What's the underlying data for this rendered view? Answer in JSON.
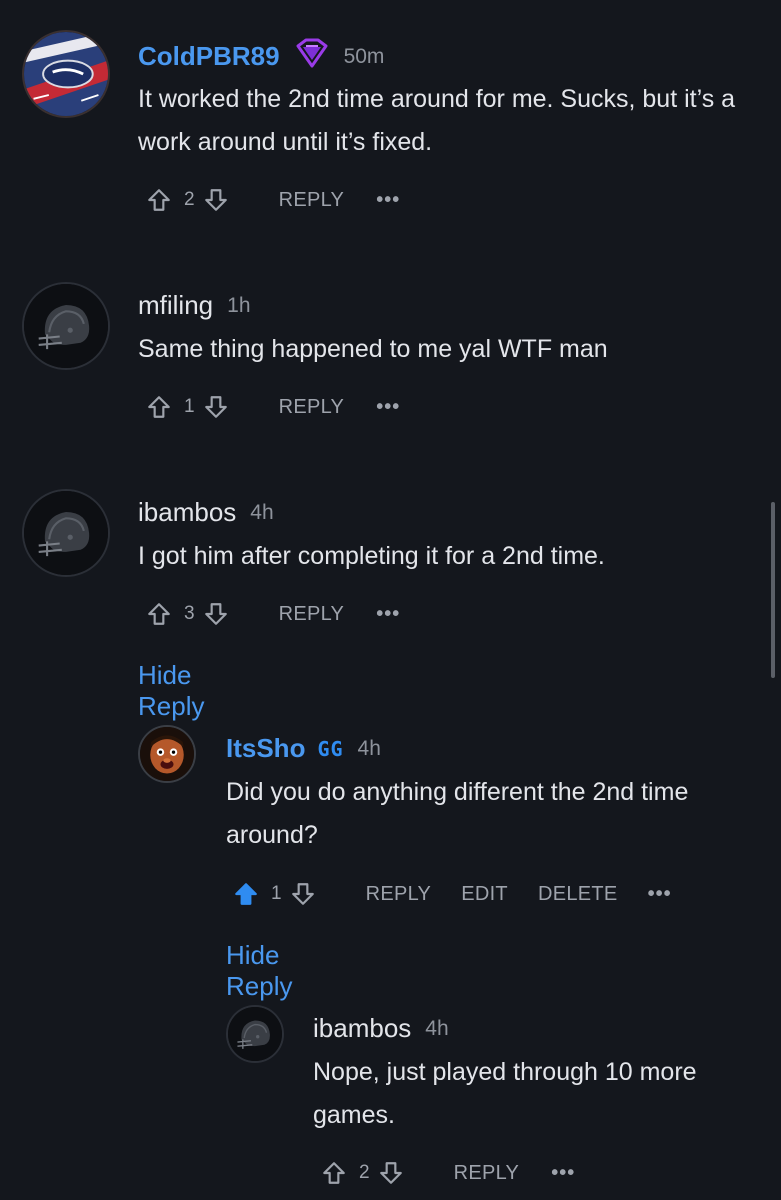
{
  "colors": {
    "background": "#14171d",
    "text": "#e3e5ea",
    "muted": "#8e939c",
    "link": "#4a98ef",
    "upvote_active": "#2f8cf1"
  },
  "comments": [
    {
      "username": "ColdPBR89",
      "badge_icon": "purple-gem-badge-icon",
      "time": "50m",
      "text": "It worked the 2nd time around for me. Sucks, but it’s a work around until it’s fixed.",
      "votes": "2",
      "reply_label": "REPLY",
      "more_label": "•••"
    },
    {
      "username": "mfiling",
      "time": "1h",
      "text": "Same thing happened to me yal WTF man",
      "votes": "1",
      "reply_label": "REPLY",
      "more_label": "•••"
    },
    {
      "username": "ibambos",
      "time": "4h",
      "text": "I got him after completing it for a 2nd time.",
      "votes": "3",
      "reply_label": "REPLY",
      "more_label": "•••",
      "hide_reply_label": "Hide Reply"
    },
    {
      "username": "ItsSho",
      "badge_text": "GG",
      "time": "4h",
      "text": "Did you do anything different the 2nd time around?",
      "votes": "1",
      "upvoted": true,
      "reply_label": "REPLY",
      "edit_label": "EDIT",
      "delete_label": "DELETE",
      "more_label": "•••",
      "hide_reply_label": "Hide Reply"
    },
    {
      "username": "ibambos",
      "time": "4h",
      "text": "Nope, just played through 10 more games.",
      "votes": "2",
      "reply_label": "REPLY",
      "more_label": "•••"
    }
  ]
}
